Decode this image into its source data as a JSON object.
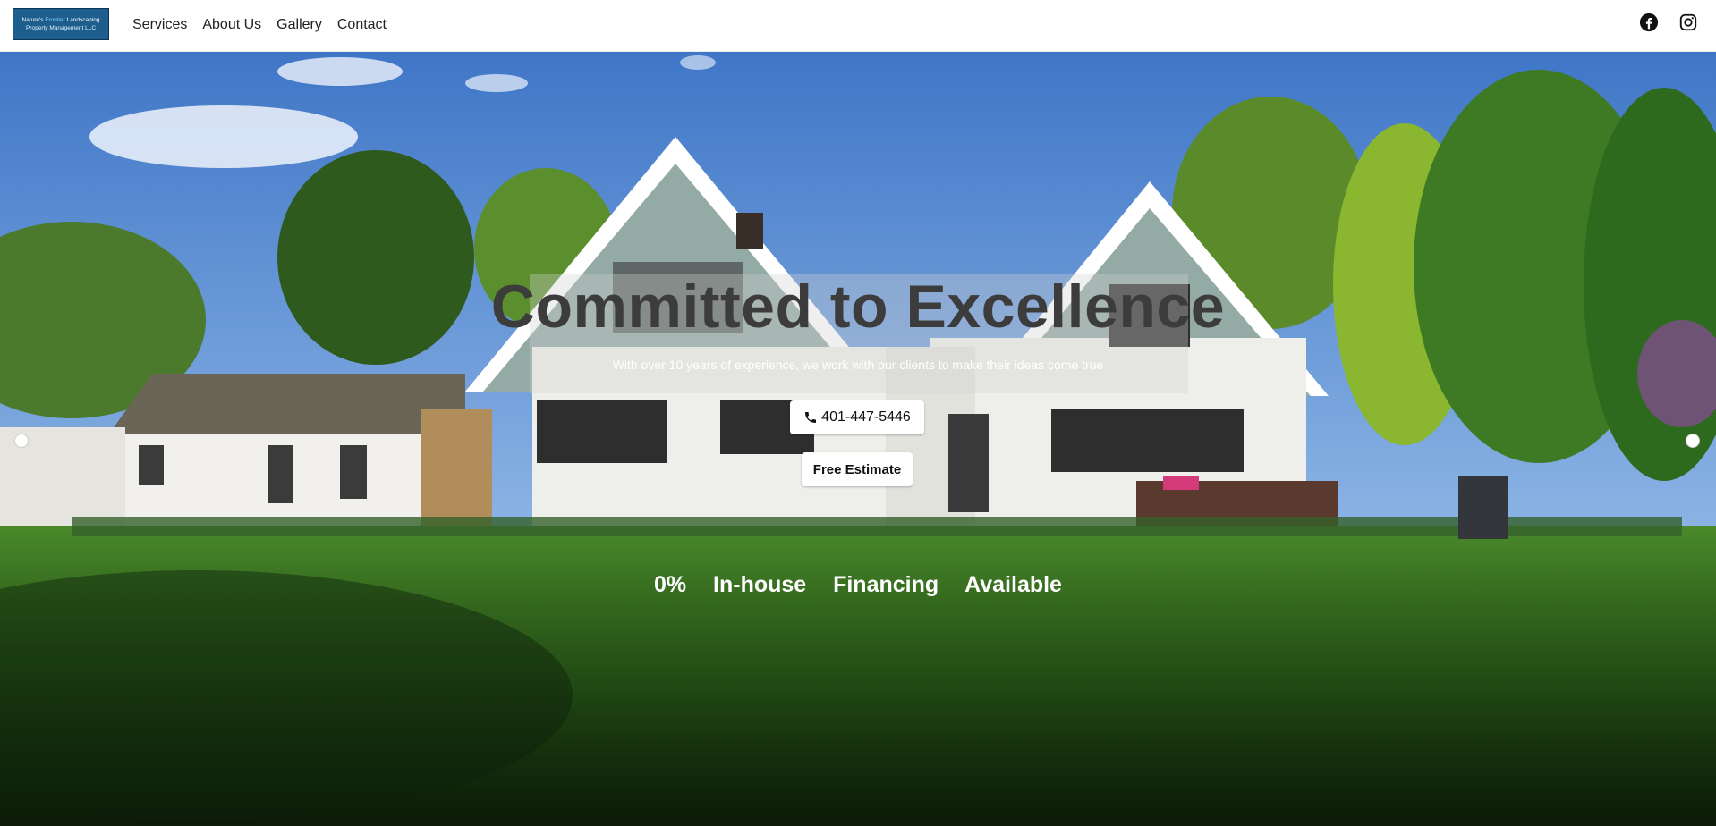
{
  "logo": {
    "line1_prefix": "Nature's",
    "line1_accent": "Frontier",
    "line1_suffix": "Landscaping",
    "line2": "Property Management LLC"
  },
  "nav": {
    "items": [
      {
        "label": "Services"
      },
      {
        "label": "About Us"
      },
      {
        "label": "Gallery"
      },
      {
        "label": "Contact"
      }
    ]
  },
  "social": {
    "icons": [
      "facebook-icon",
      "instagram-icon"
    ]
  },
  "hero": {
    "headline": "Committed to Excellence",
    "subline": "With over 10 years of experience, we work with our clients to make their ideas come true",
    "phone_label": "401-447-5446",
    "estimate_label": "Free Estimate",
    "financing": "0%  In-house  Financing  Available"
  },
  "colors": {
    "sky": "#4f86d0",
    "lawn": "#3f7a24",
    "house_siding": "#9db3ad",
    "logo_bg": "#1d5e8c"
  }
}
